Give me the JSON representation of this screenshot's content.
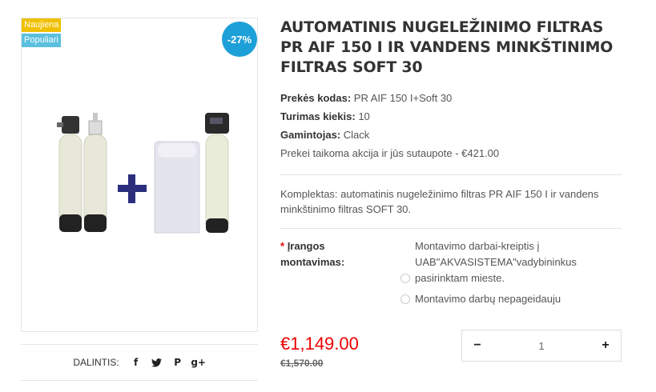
{
  "badges": {
    "new": "Naujiena",
    "popular": "Populiari",
    "discount": "-27%"
  },
  "product": {
    "title": "AUTOMATINIS NUGELEŽINIMO FILTRAS PR AIF 150 I IR VANDENS MINKŠTINIMO FILTRAS SOFT 30",
    "code_label": "Prekės kodas:",
    "code_value": "PR AIF 150 I+Soft 30",
    "stock_label": "Turimas kiekis:",
    "stock_value": "10",
    "maker_label": "Gamintojas:",
    "maker_value": "Clack",
    "promo": "Prekei taikoma akcija ir jūs sutaupote - €421.00",
    "description": "Komplektas: automatinis nugeležinimo filtras PR AIF 150 I ir  vandens minkštinimo filtras SOFT 30."
  },
  "options": {
    "required_mark": "*",
    "label": "Įrangos montavimas:",
    "choices": [
      "Montavimo darbai-kreiptis į UAB\"AKVASISTEMA\"vadybininkus pasirinktam mieste.",
      "Montavimo darbų nepageidauju"
    ]
  },
  "pricing": {
    "price": "€1,149.00",
    "old_price": "€1,570.00"
  },
  "quantity": {
    "minus": "−",
    "value": "1",
    "plus": "+"
  },
  "share": {
    "label": "DALINTIS:",
    "icons": [
      "facebook-icon",
      "twitter-icon",
      "pinterest-icon",
      "google-plus-icon"
    ]
  }
}
